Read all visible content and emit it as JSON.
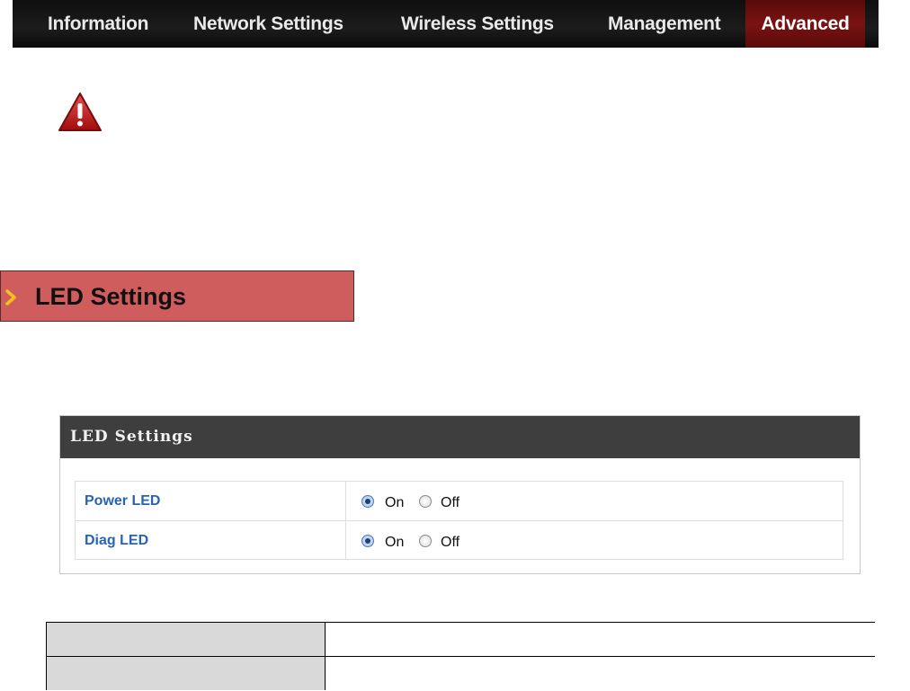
{
  "nav": {
    "items": [
      {
        "label": "Information"
      },
      {
        "label": "Network Settings"
      },
      {
        "label": "Wireless Settings"
      },
      {
        "label": "Management"
      },
      {
        "label": "Advanced",
        "active": true
      }
    ]
  },
  "colors": {
    "nav_bg": "#111111",
    "nav_active": "#6e1010",
    "section_bar": "#cf5d5d",
    "panel_header": "#3e3e3e",
    "label_blue": "#2863b4"
  },
  "icons": {
    "warning": "warning-triangle-icon",
    "chevron": "chevron-right-icon"
  },
  "section": {
    "title": "LED Settings"
  },
  "panel": {
    "title": "LED Settings",
    "rows": [
      {
        "label": "Power LED",
        "on_label": "On",
        "off_label": "Off",
        "selected": "On"
      },
      {
        "label": "Diag LED",
        "on_label": "On",
        "off_label": "Off",
        "selected": "On"
      }
    ]
  },
  "description_table": {
    "rows": [
      {
        "field": "",
        "description": ""
      },
      {
        "field": "",
        "description": ""
      }
    ]
  }
}
